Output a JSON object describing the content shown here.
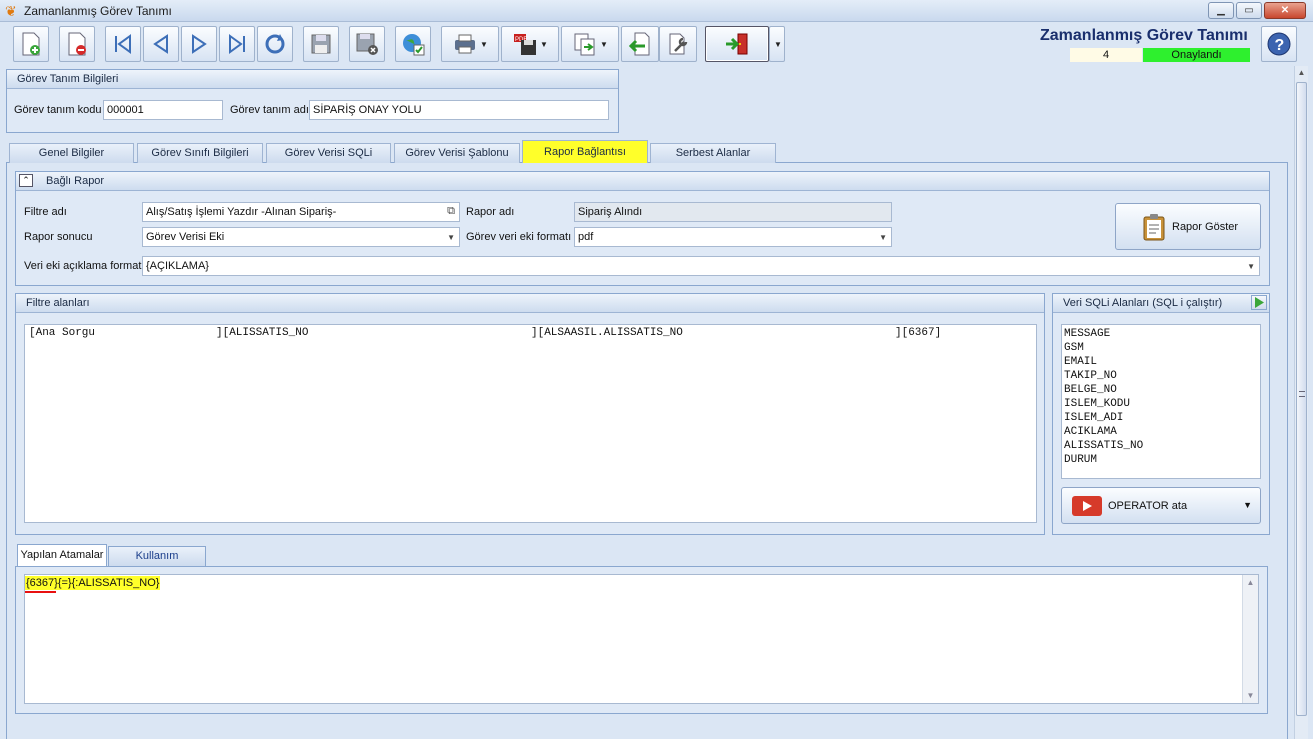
{
  "window": {
    "title": "Zamanlanmış Görev Tanımı"
  },
  "header": {
    "title": "Zamanlanmış Görev Tanımı",
    "record_number": "4",
    "status": "Onaylandı",
    "status_color": "#2ef02e"
  },
  "toolbar": {
    "icons": [
      "new-document-icon",
      "delete-document-icon",
      "first-record-icon",
      "previous-record-icon",
      "next-record-icon",
      "last-record-icon",
      "refresh-icon",
      "save-icon",
      "cancel-save-icon",
      "approve-globe-icon",
      "print-icon",
      "pdf-save-icon",
      "copy-icon",
      "import-icon",
      "tools-icon",
      "exit-door-icon",
      "help-icon"
    ]
  },
  "gorev_tanim": {
    "group_title": "Görev Tanım Bilgileri",
    "kod_label": "Görev tanım kodu",
    "kod_value": "000001",
    "ad_label": "Görev tanım adı",
    "ad_value": "SİPARİŞ ONAY YOLU"
  },
  "tabs": [
    {
      "label": "Genel Bilgiler"
    },
    {
      "label": "Görev Sınıfı Bilgileri"
    },
    {
      "label": "Görev Verisi SQLi"
    },
    {
      "label": "Görev Verisi Şablonu"
    },
    {
      "label": "Rapor Bağlantısı",
      "active": true
    },
    {
      "label": "Serbest Alanlar"
    }
  ],
  "bagli_rapor": {
    "group_title": "Bağlı Rapor",
    "filtre_label": "Filtre adı",
    "filtre_value": "Alış/Satış İşlemi Yazdır -Alınan Sipariş-",
    "rapor_adi_label": "Rapor adı",
    "rapor_adi_value": "Sipariş Alındı",
    "sonuc_label": "Rapor sonucu",
    "sonuc_value": "Görev Verisi Eki",
    "format_label": "Görev veri eki formatı",
    "format_value": "pdf",
    "aciklama_label": "Veri eki açıklama formatı",
    "aciklama_value": "{AÇIKLAMA}",
    "rapor_goster": "Rapor Göster"
  },
  "filtre_alanlari": {
    "group_title": "Filtre alanları",
    "row": [
      "[Ana Sorgu",
      "][ALISSATIS_NO",
      "][ALSAASIL.ALISSATIS_NO",
      "][6367]"
    ]
  },
  "sql_alanlari": {
    "group_title": "Veri SQLi Alanları (SQL i çalıştır)",
    "items": [
      "MESSAGE",
      "GSM",
      "EMAIL",
      "TAKIP_NO",
      "BELGE_NO",
      "ISLEM_KODU",
      "ISLEM_ADI",
      "ACIKLAMA",
      "ALISSATIS_NO",
      "DURUM"
    ],
    "operator_button": "OPERATOR ata"
  },
  "bottom_tabs": [
    {
      "label": "Yapılan Atamalar",
      "active": true
    },
    {
      "label": "Kullanım Açıklaması"
    }
  ],
  "atamalar": {
    "text": "{6367}{=}{:ALISSATIS_NO}",
    "highlight_color": "#ffff2a"
  }
}
